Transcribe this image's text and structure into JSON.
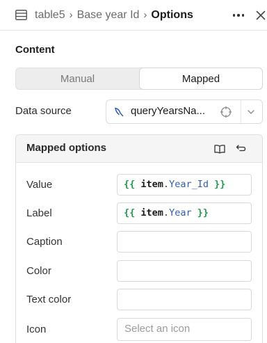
{
  "header": {
    "breadcrumb": [
      "table5",
      "Base year Id",
      "Options"
    ],
    "separator": "›"
  },
  "content": {
    "title": "Content",
    "mode_tabs": [
      {
        "label": "Manual",
        "selected": false
      },
      {
        "label": "Mapped",
        "selected": true
      }
    ],
    "data_source": {
      "label": "Data source",
      "value": "queryYearsNa..."
    }
  },
  "mapped_options": {
    "title": "Mapped options",
    "rows": [
      {
        "label": "Value",
        "expr": {
          "open": "{{",
          "var": "item",
          "dot": ".",
          "prop": "Year_Id",
          "close": "}}"
        }
      },
      {
        "label": "Label",
        "expr": {
          "open": "{{",
          "var": "item",
          "dot": ".",
          "prop": "Year",
          "close": "}}"
        }
      },
      {
        "label": "Caption",
        "value": ""
      },
      {
        "label": "Color",
        "value": ""
      },
      {
        "label": "Text color",
        "value": ""
      },
      {
        "label": "Icon",
        "placeholder": "Select an icon"
      }
    ]
  },
  "icons": {
    "table": "table-icon",
    "more": "more-horizontal-icon",
    "close": "close-icon",
    "query": "query-icon",
    "target": "crosshair-icon",
    "chevron": "chevron-down-icon",
    "docs": "book-icon",
    "revert": "return-arrow-icon"
  },
  "colors": {
    "brace": "#1f9d4c",
    "property": "#2f5fb3",
    "segment_bg": "#ededed"
  }
}
